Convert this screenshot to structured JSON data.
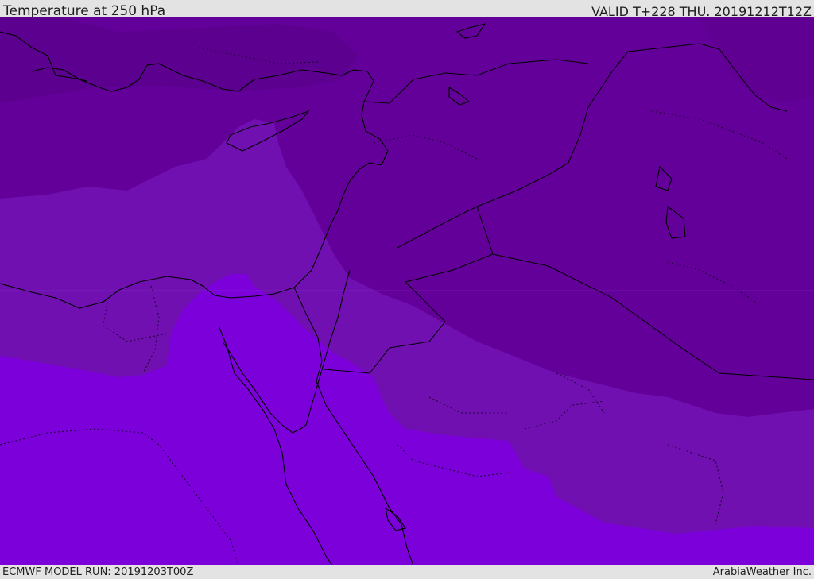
{
  "header": {
    "title": "Temperature at 250 hPa",
    "valid": "VALID T+228 THU. 20191212T12Z"
  },
  "footer": {
    "model_run": "ECMWF MODEL RUN: 20191203T00Z",
    "credit": "ArabiaWeather Inc."
  },
  "map": {
    "variable": "temperature",
    "level": "250 hPa",
    "colors": {
      "coldest_band": "#5c0090",
      "cold_band": "#64009a",
      "mid_band": "#7010b0",
      "warm_band": "#7c00da",
      "coastline": "#000000",
      "border": "#000000"
    }
  }
}
